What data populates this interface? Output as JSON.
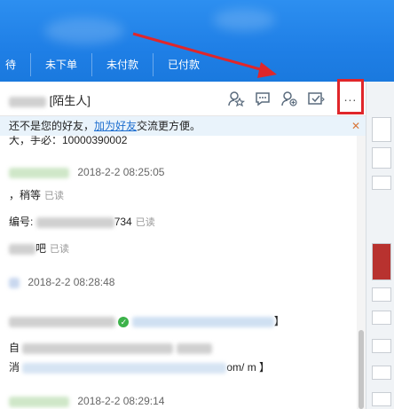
{
  "tabs": [
    "待",
    "未下单",
    "未付款",
    "已付款"
  ],
  "contact": {
    "tag": "[陌生人]"
  },
  "header_icons": [
    "star-contact-icon",
    "chat-bubble-icon",
    "add-friend-icon",
    "send-invite-icon"
  ],
  "more_label": "...",
  "notice": {
    "prefix": "还不是您的好友，",
    "link": "加为好友",
    "suffix": "交流更方便。",
    "close": "✕"
  },
  "messages": {
    "m0": "大，手必：10000390002",
    "m1_time": "2018-2-2 08:25:05",
    "m2_text": "，稍等",
    "m2_read": "已读",
    "m3_prefix": "编号:",
    "m3_suffix": "734",
    "m3_read": "已读",
    "m4_text": "吧",
    "m4_read": "已读",
    "m5_time": "2018-2-2 08:28:48",
    "m6_end": "】",
    "m7_prefix": "自",
    "m8_prefix": "消",
    "m8_suffix": "om/ m 】",
    "m9_time": "2018-2-2 08:29:14"
  },
  "colors": {
    "accent": "#1f7fe6",
    "highlight": "#e0262a",
    "link": "#1f6fcf"
  }
}
